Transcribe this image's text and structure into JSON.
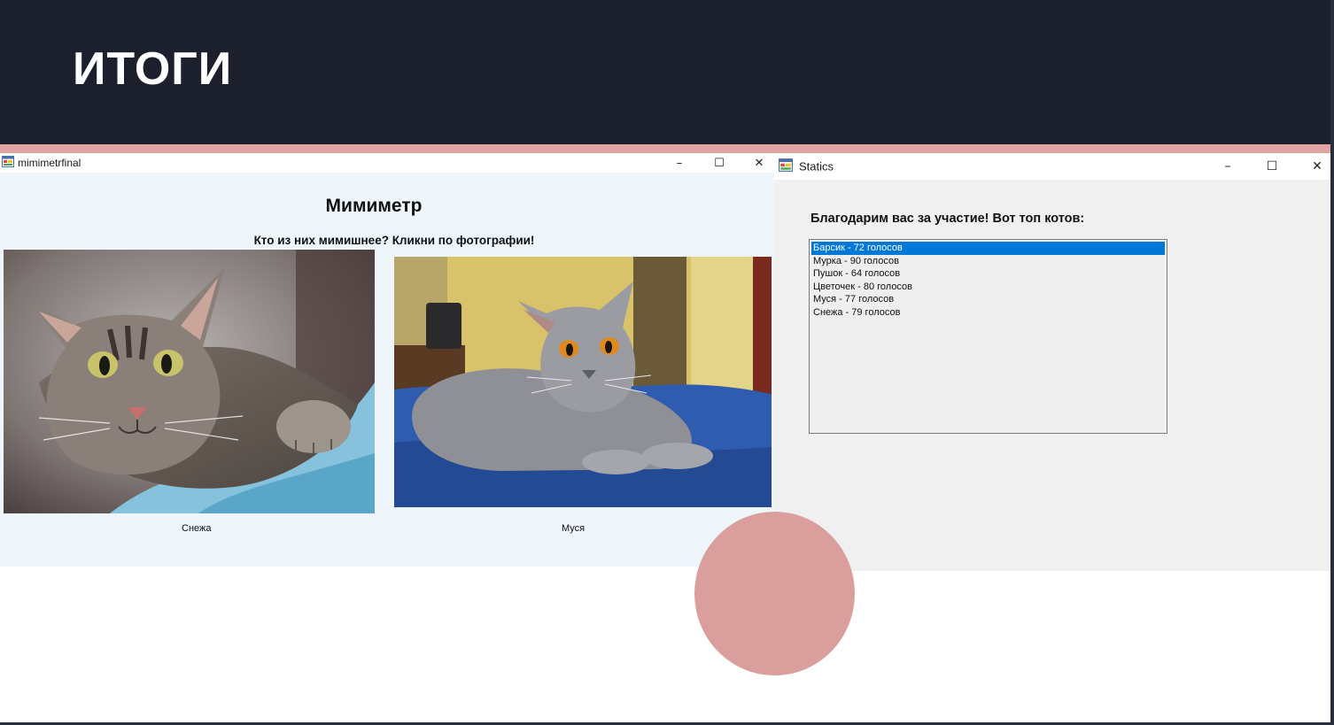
{
  "slide": {
    "title": "ИТОГИ"
  },
  "colors": {
    "header_bg": "#1c1f2c",
    "accent": "#e0a5a2",
    "circle": "#da9e9c",
    "selection": "#0078d7"
  },
  "mimimeter_window": {
    "title": "mimimetrfinal",
    "icon": "app-form-icon",
    "heading": "Мимиметр",
    "subtitle": "Кто из них мимишнее? Кликни по фотографии!",
    "photos": [
      {
        "caption": "Снежа",
        "icon": "tabby-cat-photo"
      },
      {
        "caption": "Муся",
        "icon": "gray-british-cat-photo"
      }
    ]
  },
  "statics_window": {
    "title": "Statics",
    "icon": "app-form-icon",
    "heading": "Благодарим вас за участие! Вот топ котов:",
    "list": [
      "Барсик - 72 голосов",
      "Мурка - 90 голосов",
      "Пушок - 64 голосов",
      "Цветочек - 80 голосов",
      "Муся - 77 голосов",
      "Снежа - 79 голосов"
    ],
    "selected_index": 0
  },
  "window_buttons": {
    "minimize": "–",
    "maximize": "☐",
    "close": "✕"
  }
}
